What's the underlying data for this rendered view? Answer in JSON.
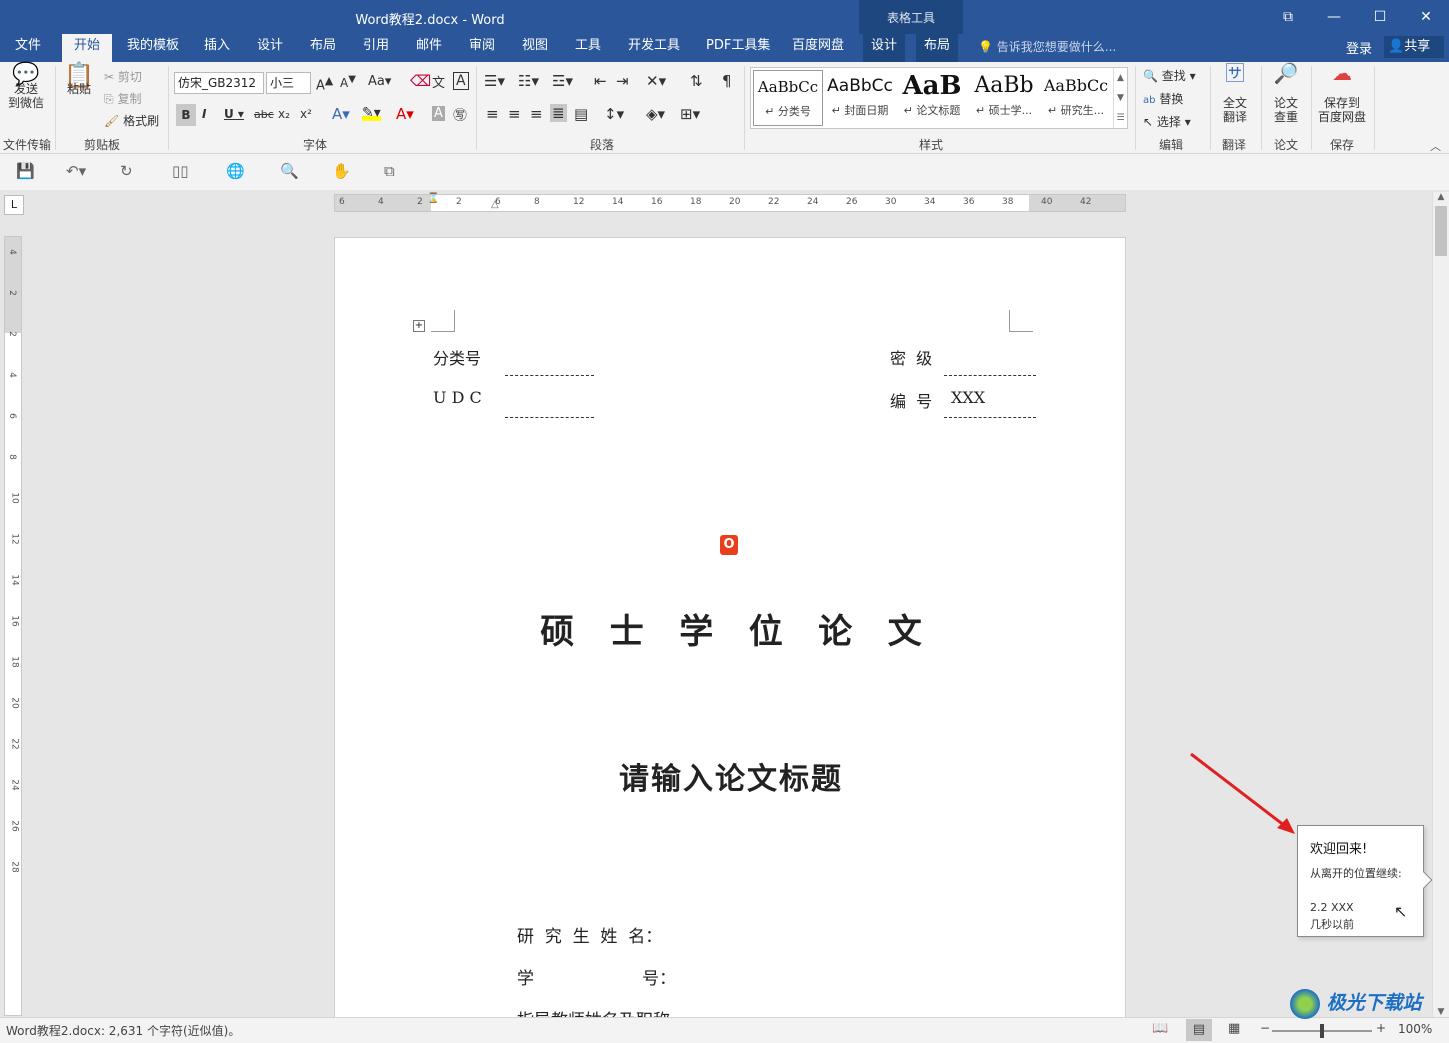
{
  "window": {
    "title": "Word教程2.docx - Word",
    "context_group": "表格工具"
  },
  "tabs": [
    "文件",
    "开始",
    "我的模板",
    "插入",
    "设计",
    "布局",
    "引用",
    "邮件",
    "审阅",
    "视图",
    "工具",
    "开发工具",
    "PDF工具集",
    "百度网盘",
    "设计",
    "布局"
  ],
  "tell_me": "告诉我您想要做什么...",
  "account": {
    "login": "登录",
    "share": "共享"
  },
  "ribbon": {
    "send_wechat": "发送\n到微信",
    "group_file_transfer": "文件传输",
    "paste": "粘贴",
    "cut": "剪切",
    "copy": "复制",
    "format_painter": "格式刷",
    "group_clipboard": "剪贴板",
    "font_name": "仿宋_GB2312",
    "font_size": "小三",
    "group_font": "字体",
    "group_paragraph": "段落",
    "styles": [
      {
        "preview": "AaBbCc",
        "name": "分类号"
      },
      {
        "preview": "AaBbCc",
        "name": "封面日期"
      },
      {
        "preview": "AaB",
        "name": "论文标题"
      },
      {
        "preview": "AaBb",
        "name": "硕士学..."
      },
      {
        "preview": "AaBbCc",
        "name": "研究生..."
      }
    ],
    "group_styles": "样式",
    "find": "查找",
    "replace": "替换",
    "select": "选择",
    "group_edit": "编辑",
    "full_translate": "全文\n翻译",
    "group_translate": "翻译",
    "paper_check": "论文\n查重",
    "group_paper": "论文",
    "save_baidu": "保存到\n百度网盘",
    "group_save": "保存"
  },
  "document": {
    "classification_label": "分类号",
    "udc_label": "U D C",
    "secret_label": "密  级",
    "number_label": "编  号",
    "number_value": "XXX",
    "main_title": "硕   士   学   位   论   文",
    "thesis_title": "请输入论文标题",
    "fields": [
      "研  究  生  姓  名：",
      "学                    号：",
      "指导教师姓名及职称"
    ]
  },
  "popup": {
    "title": "欢迎回来!",
    "subtitle": "从离开的位置继续:",
    "section": "2.2 XXX",
    "time": "几秒以前"
  },
  "status": {
    "doc_info": "Word教程2.docx: 2,631 个字符(近似值)。",
    "zoom": "100%"
  },
  "ruler_marks": [
    "6",
    "4",
    "2",
    "2",
    "6",
    "8",
    "12",
    "14",
    "16",
    "18",
    "20",
    "22",
    "24",
    "26",
    "30",
    "34",
    "36",
    "38",
    "40",
    "42"
  ],
  "vruler_marks": [
    "4",
    "2",
    "2",
    "4",
    "6",
    "8",
    "10",
    "12",
    "14",
    "16",
    "18",
    "20",
    "22",
    "24",
    "26",
    "28"
  ],
  "watermark": "极光下载站"
}
